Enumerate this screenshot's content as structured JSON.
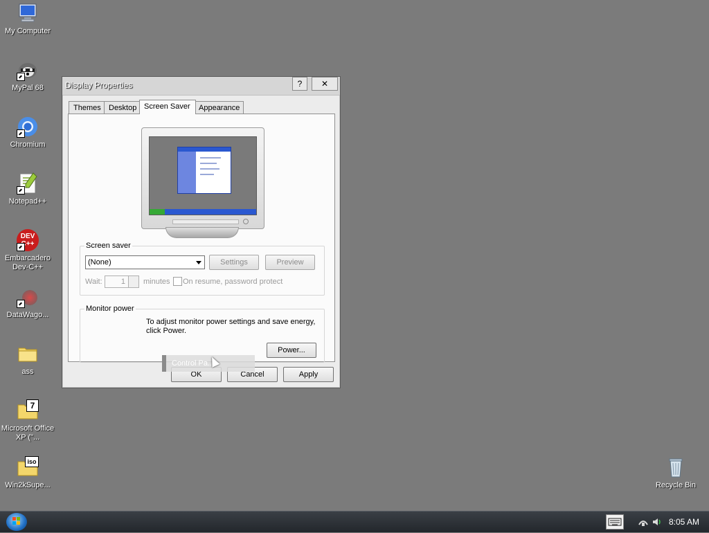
{
  "desktop": {
    "icons": [
      {
        "label": "My Computer"
      },
      {
        "label": "MyPal 68"
      },
      {
        "label": "Chromium"
      },
      {
        "label": "Notepad++"
      },
      {
        "label": "Embarcadero Dev-C++",
        "logo_text": "DEV C++"
      },
      {
        "label": "DataWago..."
      },
      {
        "label": "ass"
      },
      {
        "label": "Microsoft Office XP (\"...",
        "badge_text": "7"
      },
      {
        "label": "Win2kSupe...",
        "badge_text": "iso"
      },
      {
        "label": "Recycle Bin"
      }
    ]
  },
  "window": {
    "title": "Display Properties",
    "help_label": "?",
    "close_label": "✕",
    "tabs": [
      {
        "label": "Themes"
      },
      {
        "label": "Desktop"
      },
      {
        "label": "Screen Saver",
        "active": true
      },
      {
        "label": "Appearance"
      }
    ],
    "screen_saver": {
      "group_title": "Screen saver",
      "selected": "(None)",
      "settings_label": "Settings",
      "preview_label": "Preview",
      "wait_label": "Wait:",
      "wait_value": "1",
      "minutes_label": "minutes",
      "resume_label": "On resume, password protect"
    },
    "monitor_power": {
      "group_title": "Monitor power",
      "text": "To adjust monitor power settings and save energy, click Power.",
      "power_label": "Power..."
    },
    "ok_label": "OK",
    "cancel_label": "Cancel",
    "apply_label": "Apply"
  },
  "drag_ghost": {
    "text": "Control Pa..."
  },
  "taskbar": {
    "clock": "8:05 AM",
    "tray_icons": [
      "keyboard-icon",
      "network-icon",
      "speaker-icon"
    ]
  },
  "colors": {
    "desktop": "#7b7b7b",
    "taskbar": "#2b3036",
    "window": "#ececec"
  }
}
